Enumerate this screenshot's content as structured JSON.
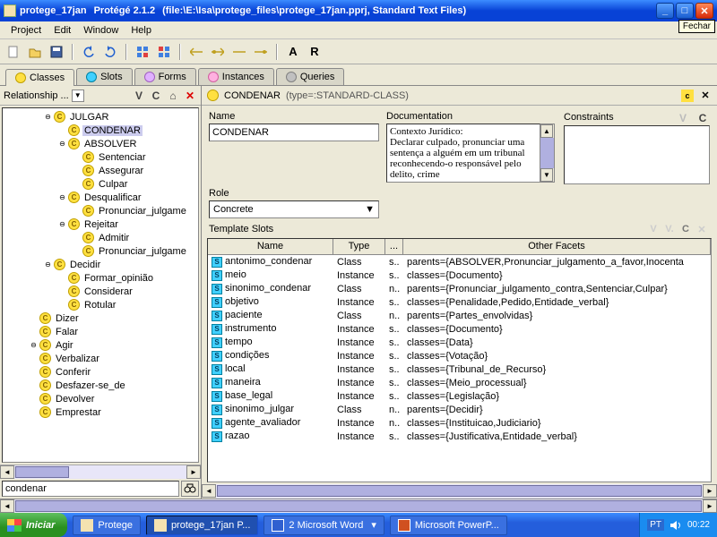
{
  "window": {
    "filename": "protege_17jan",
    "app": "Protégé 2.1.2",
    "path": "(file:\\E:\\Isa\\protege_files\\protege_17jan.pprj, Standard Text Files)",
    "tooltip": "Fechar"
  },
  "menu": {
    "project": "Project",
    "edit": "Edit",
    "window": "Window",
    "help": "Help"
  },
  "tabs": {
    "classes": "Classes",
    "slots": "Slots",
    "forms": "Forms",
    "instances": "Instances",
    "queries": "Queries"
  },
  "left": {
    "label": "Relationship",
    "v": "V",
    "c": "C",
    "search_value": "condenar",
    "tree": [
      {
        "ind": 2,
        "t": "o",
        "txt": "JULGAR"
      },
      {
        "ind": 3,
        "t": "",
        "txt": "CONDENAR",
        "sel": true
      },
      {
        "ind": 3,
        "t": "o",
        "txt": "ABSOLVER"
      },
      {
        "ind": 4,
        "t": "",
        "txt": "Sentenciar"
      },
      {
        "ind": 4,
        "t": "",
        "txt": "Assegurar"
      },
      {
        "ind": 4,
        "t": "",
        "txt": "Culpar"
      },
      {
        "ind": 3,
        "t": "o",
        "txt": "Desqualificar"
      },
      {
        "ind": 4,
        "t": "",
        "txt": "Pronunciar_julgame"
      },
      {
        "ind": 3,
        "t": "o",
        "txt": "Rejeitar"
      },
      {
        "ind": 4,
        "t": "",
        "txt": "Admitir"
      },
      {
        "ind": 4,
        "t": "",
        "txt": "Pronunciar_julgame"
      },
      {
        "ind": 2,
        "t": "o",
        "txt": "Decidir"
      },
      {
        "ind": 3,
        "t": "",
        "txt": "Formar_opinião"
      },
      {
        "ind": 3,
        "t": "",
        "txt": "Considerar"
      },
      {
        "ind": 3,
        "t": "",
        "txt": "Rotular"
      },
      {
        "ind": 1,
        "t": "",
        "txt": "Dizer"
      },
      {
        "ind": 1,
        "t": "",
        "txt": "Falar"
      },
      {
        "ind": 1,
        "t": "o",
        "txt": "Agir"
      },
      {
        "ind": 1,
        "t": "",
        "txt": "Verbalizar"
      },
      {
        "ind": 1,
        "t": "",
        "txt": "Conferir"
      },
      {
        "ind": 1,
        "t": "",
        "txt": "Desfazer-se_de"
      },
      {
        "ind": 1,
        "t": "",
        "txt": "Devolver"
      },
      {
        "ind": 1,
        "t": "",
        "txt": "Emprestar"
      }
    ]
  },
  "right": {
    "class": "CONDENAR",
    "type": "(type=:STANDARD-CLASS)",
    "labels": {
      "name": "Name",
      "doc": "Documentation",
      "con": "Constraints",
      "role": "Role",
      "slots": "Template Slots"
    },
    "name_val": "CONDENAR",
    "role_val": "Concrete",
    "doc_val": "Contexto Jurídico:\nDeclarar culpado, pronunciar uma sentença a alguém em um tribunal reconhecendo-o responsável pelo delito, crime",
    "cols": {
      "name": "Name",
      "type": "Type",
      "dots": "...",
      "facets": "Other Facets"
    },
    "rows": [
      {
        "n": "antonimo_condenar",
        "t": "Class",
        "d": "s..",
        "f": "parents={ABSOLVER,Pronunciar_julgamento_a_favor,Inocenta"
      },
      {
        "n": "meio",
        "t": "Instance",
        "d": "s..",
        "f": "classes={Documento}"
      },
      {
        "n": "sinonimo_condenar",
        "t": "Class",
        "d": "n..",
        "f": "parents={Pronunciar_julgamento_contra,Sentenciar,Culpar}"
      },
      {
        "n": "objetivo",
        "t": "Instance",
        "d": "s..",
        "f": "classes={Penalidade,Pedido,Entidade_verbal}"
      },
      {
        "n": "paciente",
        "t": "Class",
        "d": "n..",
        "f": "parents={Partes_envolvidas}"
      },
      {
        "n": "instrumento",
        "t": "Instance",
        "d": "s..",
        "f": "classes={Documento}"
      },
      {
        "n": "tempo",
        "t": "Instance",
        "d": "s..",
        "f": "classes={Data}"
      },
      {
        "n": "condições",
        "t": "Instance",
        "d": "s..",
        "f": "classes={Votação}"
      },
      {
        "n": "local",
        "t": "Instance",
        "d": "s..",
        "f": "classes={Tribunal_de_Recurso}"
      },
      {
        "n": "maneira",
        "t": "Instance",
        "d": "s..",
        "f": "classes={Meio_processual}"
      },
      {
        "n": "base_legal",
        "t": "Instance",
        "d": "s..",
        "f": "classes={Legislação}"
      },
      {
        "n": "sinonimo_julgar",
        "t": "Class",
        "d": "n..",
        "f": "parents={Decidir}"
      },
      {
        "n": "agente_avaliador",
        "t": "Instance",
        "d": "n..",
        "f": "classes={Instituicao,Judiciario}"
      },
      {
        "n": "razao",
        "t": "Instance",
        "d": "s..",
        "f": "classes={Justificativa,Entidade_verbal}"
      }
    ]
  },
  "taskbar": {
    "start": "Iniciar",
    "t1": "Protege",
    "t2": "protege_17jan  P...",
    "t3": "2 Microsoft Word",
    "t4": "Microsoft PowerP...",
    "lang": "PT",
    "time": "00:22"
  }
}
